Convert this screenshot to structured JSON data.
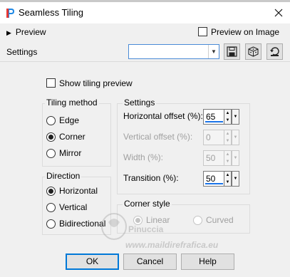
{
  "window": {
    "title": "Seamless Tiling"
  },
  "toolbar": {
    "preview_label": "Preview",
    "preview_on_image_label": "Preview on Image",
    "settings_label": "Settings",
    "preset_value": ""
  },
  "main": {
    "show_tiling_preview_label": "Show tiling preview",
    "tiling_method": {
      "title": "Tiling method",
      "options": [
        "Edge",
        "Corner",
        "Mirror"
      ],
      "selected": "Corner"
    },
    "direction": {
      "title": "Direction",
      "options": [
        "Horizontal",
        "Vertical",
        "Bidirectional"
      ],
      "selected": "Horizontal"
    },
    "settings": {
      "title": "Settings",
      "horizontal_offset": {
        "label": "Horizontal offset (%):",
        "value": "65"
      },
      "vertical_offset": {
        "label": "Vertical offset (%):",
        "value": "0"
      },
      "width": {
        "label": "Width (%):",
        "value": "50"
      },
      "transition": {
        "label": "Transition (%):",
        "value": "50"
      }
    },
    "corner_style": {
      "title": "Corner style",
      "options": [
        "Linear",
        "Curved"
      ],
      "selected": "Linear"
    }
  },
  "buttons": {
    "ok": "OK",
    "cancel": "Cancel",
    "help": "Help"
  },
  "watermark": {
    "line1": "Pinuccia",
    "line2": "www.maildirefrafica.eu"
  },
  "colors": {
    "accent": "#0078d7",
    "field_underline": "#1a73e8",
    "logo_blue": "#1e88e5",
    "logo_red": "#e53935"
  }
}
